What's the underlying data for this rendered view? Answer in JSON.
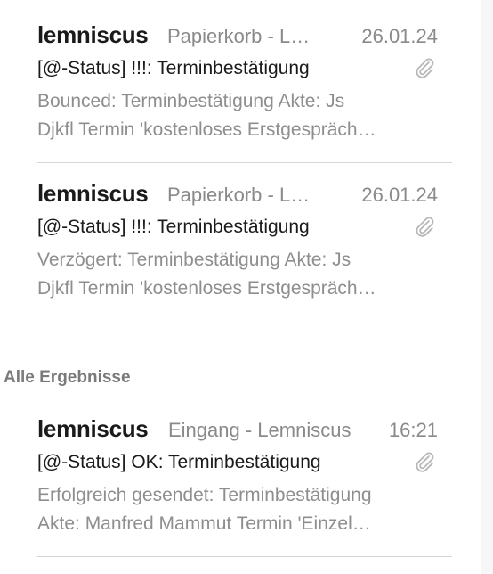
{
  "section_header": "Alle Ergebnisse",
  "messages_top": [
    {
      "sender": "lemniscus",
      "folder": "Papierkorb - L…",
      "date": "26.01.24",
      "subject": "[@-Status] !!!: Terminbestätigung",
      "preview_line1": "Bounced: Terminbestätigung Akte: Js",
      "preview_line2": "Djkfl Termin 'kostenloses Erstgespräch…",
      "has_attachment": true
    },
    {
      "sender": "lemniscus",
      "folder": "Papierkorb - L…",
      "date": "26.01.24",
      "subject": "[@-Status] !!!: Terminbestätigung",
      "preview_line1": "Verzögert: Terminbestätigung Akte: Js",
      "preview_line2": "Djkfl Termin 'kostenloses Erstgespräch…",
      "has_attachment": true
    }
  ],
  "messages_all": [
    {
      "sender": "lemniscus",
      "folder": "Eingang - Lemniscus",
      "date": "16:21",
      "subject": "[@-Status] OK: Terminbestätigung",
      "preview_line1": "Erfolgreich gesendet: Terminbestätigung",
      "preview_line2": "Akte: Manfred Mammut Termin 'Einzel…",
      "has_attachment": true
    }
  ],
  "icons": {
    "attachment": "paperclip-icon"
  },
  "colors": {
    "sender": "#1a1a1a",
    "meta": "#8a8a8a",
    "preview": "#8e8e8e",
    "divider": "#d6d6d6",
    "section_header": "#7a7a7a"
  }
}
